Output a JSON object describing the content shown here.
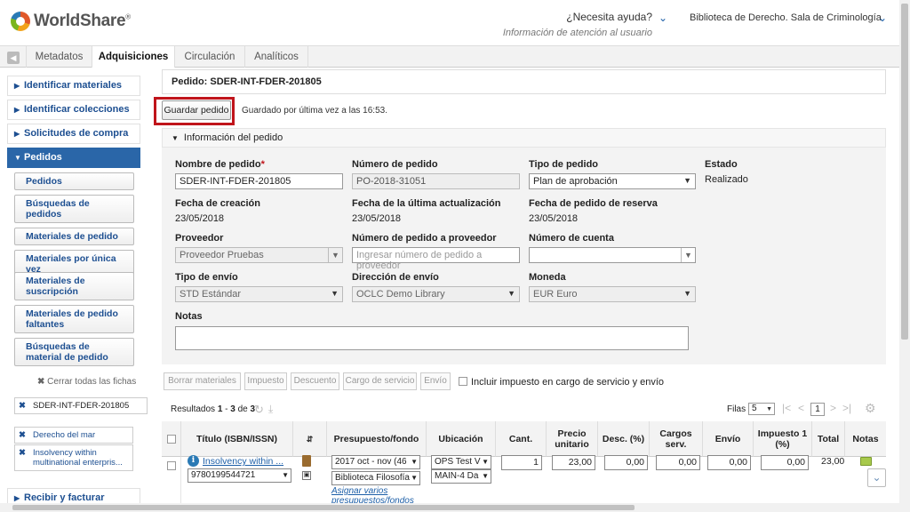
{
  "header": {
    "logo_text": "WorldShare",
    "help_title": "¿Necesita ayuda?",
    "help_subtitle": "Información de atención al usuario",
    "library": "Biblioteca de Derecho. Sala de Criminología"
  },
  "tabs": [
    "Metadatos",
    "Adquisiciones",
    "Circulación",
    "Analíticos"
  ],
  "sidebar": {
    "sections": [
      "Identificar materiales",
      "Identificar colecciones",
      "Solicitudes de compra",
      "Pedidos",
      "Recibir y facturar"
    ],
    "buttons": [
      "Pedidos",
      "Búsquedas de pedidos",
      "Materiales de pedido",
      "Materiales por única vez",
      "Materiales de suscripción",
      "Materiales de pedido faltantes",
      "Búsquedas de material de pedido"
    ],
    "close_all": "Cerrar todas las fichas",
    "open_items": [
      "SDER-INT-FDER-201805",
      "Derecho del mar",
      "Insolvency within multinational enterpris..."
    ]
  },
  "order": {
    "title": "Pedido: SDER-INT-FDER-201805",
    "save_button": "Guardar pedido",
    "saved_at": "Guardado por última vez a las 16:53.",
    "info_header": "Información del pedido",
    "labels": {
      "name": "Nombre de pedido",
      "number": "Número de pedido",
      "type": "Tipo de pedido",
      "status": "Estado",
      "created": "Fecha de creación",
      "updated": "Fecha de la última actualización",
      "reserve": "Fecha de pedido de reserva",
      "supplier": "Proveedor",
      "supplier_order": "Número de pedido a proveedor",
      "account": "Número de cuenta",
      "shipping": "Tipo de envío",
      "address": "Dirección de envío",
      "currency": "Moneda",
      "notes": "Notas"
    },
    "values": {
      "name": "SDER-INT-FDER-201805",
      "number": "PO-2018-31051",
      "type": "Plan de aprobación",
      "status": "Realizado",
      "created": "23/05/2018",
      "updated": "23/05/2018",
      "reserve": "23/05/2018",
      "supplier": "Proveedor Pruebas",
      "supplier_order_placeholder": "Ingresar número de pedido a proveedor",
      "account": "",
      "shipping": "STD Estándar",
      "address": "OCLC Demo Library",
      "currency": "EUR Euro"
    }
  },
  "toolbar": {
    "buttons": [
      "Borrar materiales",
      "Impuesto",
      "Descuento",
      "Cargo de servicio",
      "Envío"
    ],
    "tax_checkbox": "Incluir impuesto en cargo de servicio y envío"
  },
  "results": {
    "prefix": "Resultados",
    "from": "1",
    "sep": "-",
    "to": "3",
    "of": "de",
    "total": "3",
    "rows_label": "Filas",
    "rows_value": "5",
    "page": "1"
  },
  "table": {
    "headers": [
      "Título (ISBN/ISSN)",
      "Presupuesto/fondo",
      "Ubicación",
      "Cant.",
      "Precio unitario",
      "Desc. (%)",
      "Cargos serv.",
      "Envío",
      "Impuesto 1 (%)",
      "Total",
      "Notas"
    ],
    "row": {
      "title": "Insolvency within ...",
      "isbn": "9780199544721",
      "budget": "2017 oct - nov (46",
      "fund": "Biblioteca Filosofía",
      "alloc_link": "Asignar varios presupuestos/fondos",
      "location": "OPS Test V",
      "shelf": "MAIN-4 Da",
      "qty": "1",
      "price": "23,00",
      "discount": "0,00",
      "service": "0,00",
      "shipping": "0,00",
      "tax": "0,00",
      "total": "23,00"
    }
  }
}
